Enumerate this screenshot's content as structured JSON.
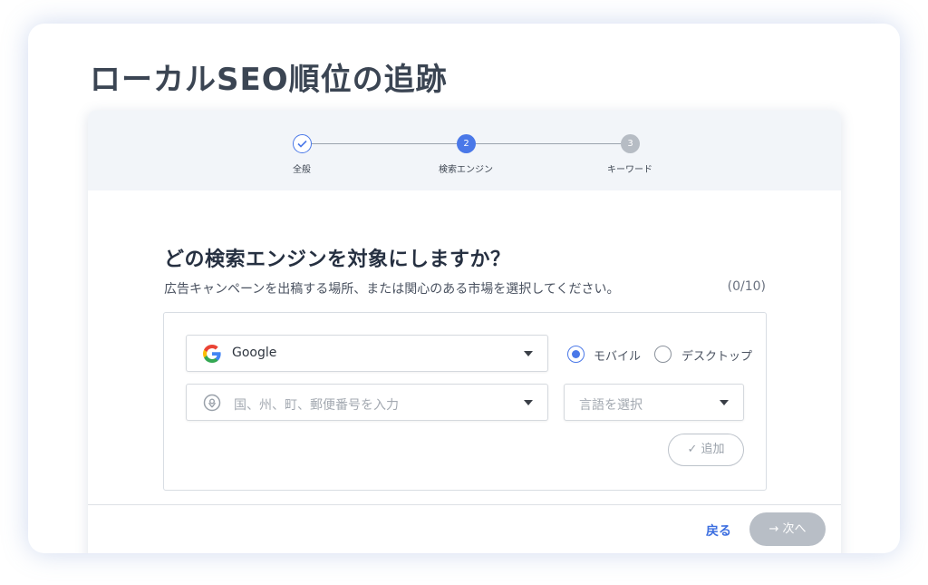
{
  "page": {
    "title": "ローカルSEO順位の追跡"
  },
  "stepper": {
    "steps": [
      {
        "number": "✓",
        "label": "全般",
        "state": "done"
      },
      {
        "number": "2",
        "label": "検索エンジン",
        "state": "active"
      },
      {
        "number": "3",
        "label": "キーワード",
        "state": "pending"
      }
    ]
  },
  "form": {
    "question": "どの検索エンジンを対象にしますか？",
    "subtitle": "広告キャンペーンを出稿する場所、または関心のある市場を選択してください。",
    "counter": "(0/10)",
    "engine": {
      "value": "Google",
      "icon": "google-icon"
    },
    "device": {
      "mobile_label": "モバイル",
      "desktop_label": "デスクトップ",
      "selected": "mobile"
    },
    "location": {
      "placeholder": "国、州、町、郵便番号を入力",
      "icon": "location-pin-icon"
    },
    "language": {
      "placeholder": "言語を選択"
    },
    "add_label": "✓ 追加"
  },
  "footer": {
    "back_label": "戻る",
    "next_label": "→ 次へ"
  },
  "colors": {
    "accent": "#4a78e8",
    "link": "#3d6fe0",
    "disabled": "#b8bec6"
  }
}
